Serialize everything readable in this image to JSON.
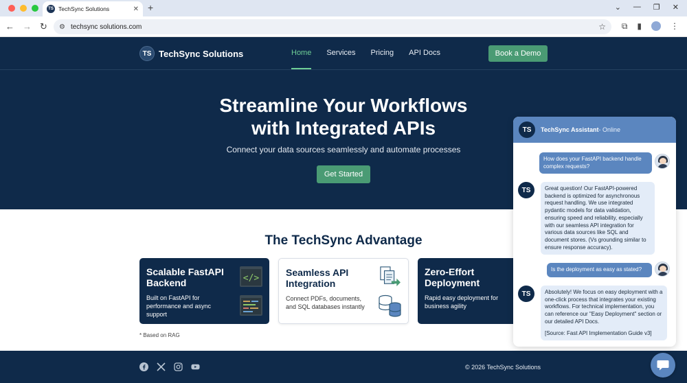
{
  "browser": {
    "tab_title": "TechSync Solutions",
    "favicon_text": "TS",
    "url": "techsync solutions.com"
  },
  "header": {
    "logo_badge": "TS",
    "logo_text": "TechSync Solutions",
    "nav": [
      "Home",
      "Services",
      "Pricing",
      "API Docs"
    ],
    "active_nav": "Home",
    "cta_label": "Book a Demo"
  },
  "hero": {
    "title_line1": "Streamline Your Workflows",
    "title_line2": "with Integrated APIs",
    "subtitle": "Connect your data sources seamlessly and automate processes",
    "button": "Get Started"
  },
  "advantage": {
    "title": "The TechSync Advantage",
    "cards": [
      {
        "title": "Scalable FastAPI Backend",
        "desc": "Built on FastAPI for performance and async support"
      },
      {
        "title": "Seamless API Integration",
        "desc": "Connect PDFs, documents, and SQL databases instantly"
      },
      {
        "title": "Zero-Effort Deployment",
        "desc": "Rapid easy deployment for business agility"
      }
    ],
    "note": "* Based on RAG"
  },
  "footer": {
    "copyright": "© 2026 TechSync Solutions",
    "socials": [
      "facebook-icon",
      "x-icon",
      "instagram-icon",
      "youtube-icon"
    ]
  },
  "chat": {
    "avatar": "TS",
    "name": "TechSync Assistant",
    "status": " - Online",
    "messages": [
      {
        "from": "user",
        "text": "How does your FastAPI backend handle complex requests?"
      },
      {
        "from": "bot",
        "text": "Great question! Our FastAPI-powered backend is optimized for asynchronous request handling. We use integrated pydantic models for data validation, ensuring speed and reliability, especially with our seamless API integration for various data sources like SQL and document stores. (Vs grounding similar to ensure response accuracy)."
      },
      {
        "from": "user",
        "text": "Is the deployment as easy as stated?"
      },
      {
        "from": "bot",
        "text": "Absolutely! We focus on easy deployment with a one-click process that integrates your existing workflows. For technical implementation, you can reference our \"Easy Deployment\" section or our detailed API Docs.",
        "source": "[Source: Fast API Implementation Guide v3]"
      }
    ]
  },
  "colors": {
    "navy": "#0f2a4a",
    "accent_green": "#4a9b74",
    "chat_blue": "#5b86bf"
  }
}
